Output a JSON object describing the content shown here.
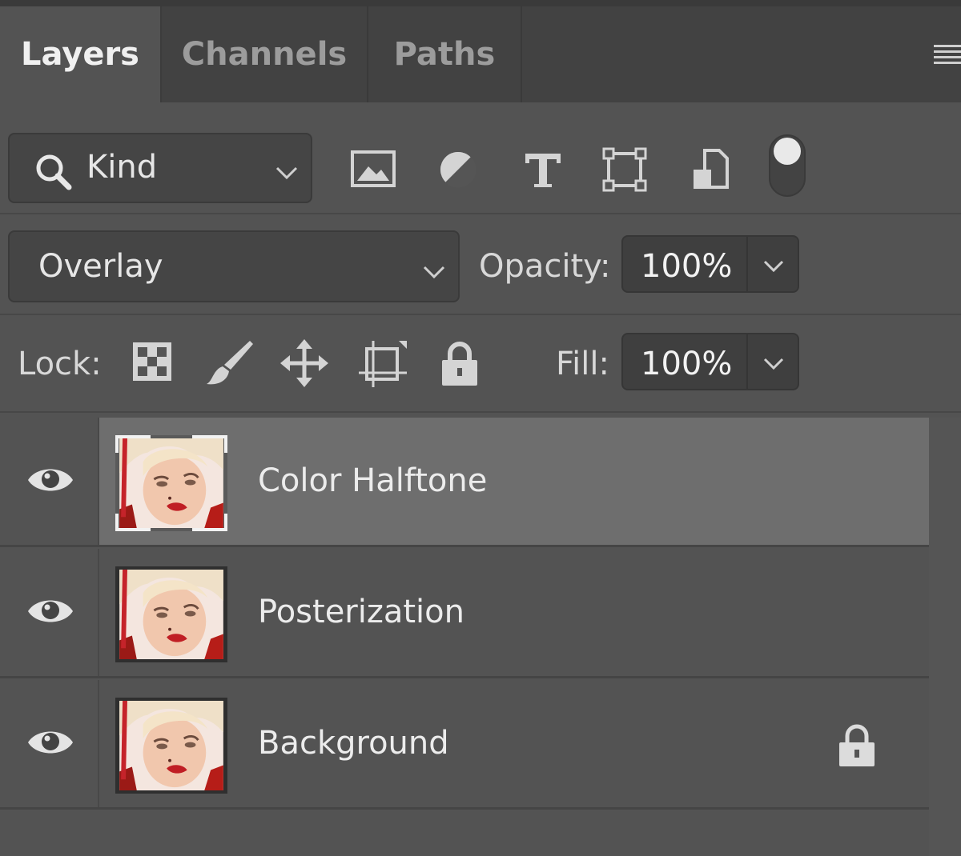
{
  "tabs": [
    {
      "label": "Layers",
      "active": true
    },
    {
      "label": "Channels",
      "active": false
    },
    {
      "label": "Paths",
      "active": false
    }
  ],
  "panel_menu_icon": "hamburger-menu-icon",
  "filter": {
    "kind_label": "Kind",
    "filter_icons": [
      "image-filter-icon",
      "adjustment-filter-icon",
      "type-filter-icon",
      "shape-filter-icon",
      "smart-object-filter-icon"
    ],
    "toggle_on": true
  },
  "blend": {
    "mode": "Overlay",
    "opacity_label": "Opacity:",
    "opacity_value": "100%"
  },
  "lock": {
    "label": "Lock:",
    "icons": [
      "lock-transparent-pixels-icon",
      "lock-image-pixels-icon",
      "lock-position-icon",
      "lock-artboard-icon",
      "lock-all-icon"
    ],
    "fill_label": "Fill:",
    "fill_value": "100%"
  },
  "layers": [
    {
      "name": "Color Halftone",
      "visible": true,
      "selected": true,
      "locked": false
    },
    {
      "name": "Posterization",
      "visible": true,
      "selected": false,
      "locked": false
    },
    {
      "name": "Background",
      "visible": true,
      "selected": false,
      "locked": true
    }
  ],
  "colors": {
    "panel_bg": "#535353",
    "tabbar_bg": "#424242",
    "selected_row": "#6e6e6e",
    "text": "#ececec"
  }
}
